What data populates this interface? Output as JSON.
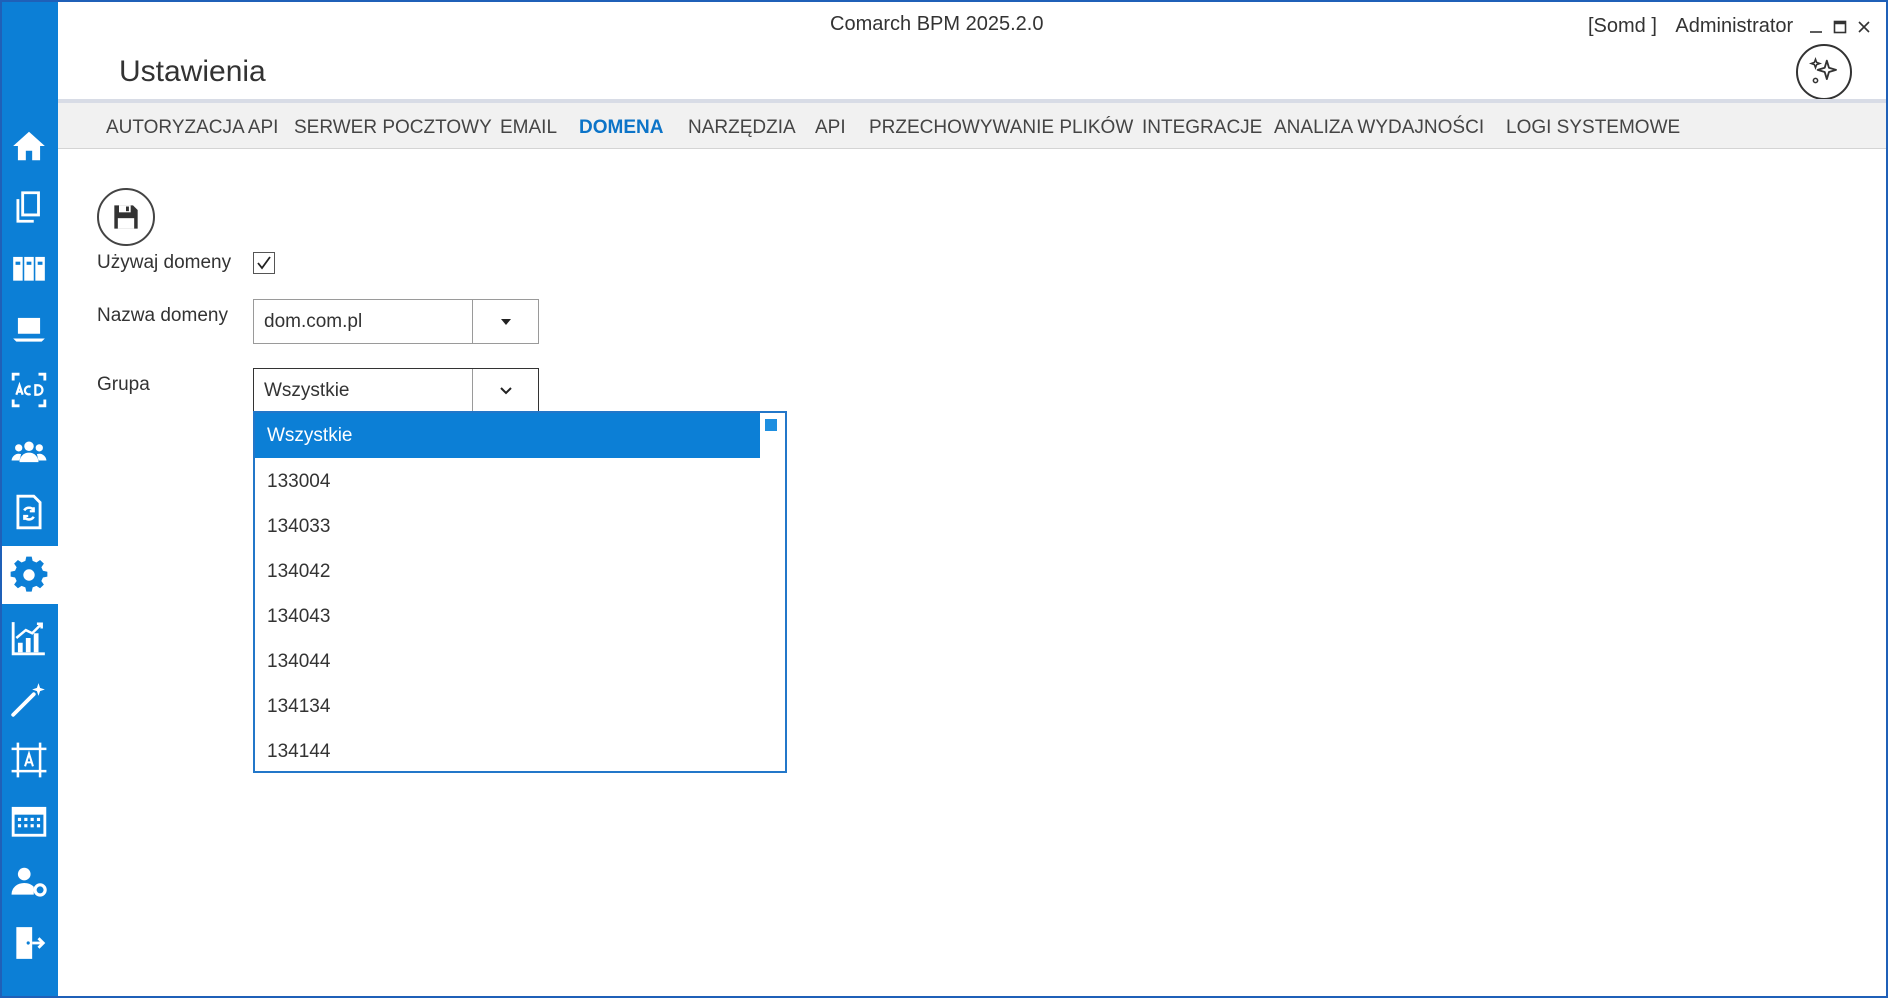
{
  "app": {
    "title": "Comarch BPM  2025.2.0",
    "environment": "[Somd ]",
    "user": "Administrator",
    "page_title": "Ustawienia"
  },
  "window_controls": {
    "minimize": "minimize-icon",
    "maximize": "maximize-icon",
    "close": "close-icon"
  },
  "sidebar": {
    "color": "#0c7fd6",
    "items": [
      {
        "icon": "home-icon"
      },
      {
        "icon": "documents-icon"
      },
      {
        "icon": "binders-icon"
      },
      {
        "icon": "laptop-icon"
      },
      {
        "icon": "acd-icon"
      },
      {
        "icon": "users-icon"
      },
      {
        "icon": "document-sync-icon"
      },
      {
        "icon": "gear-icon",
        "active": true
      },
      {
        "icon": "chart-icon"
      },
      {
        "icon": "magic-wand-icon"
      },
      {
        "icon": "designer-icon"
      },
      {
        "icon": "calendar-icon"
      },
      {
        "icon": "user-settings-icon"
      },
      {
        "icon": "logout-icon"
      }
    ]
  },
  "tabs": [
    {
      "label": "AUTORYZACJA API"
    },
    {
      "label": "SERWER POCZTOWY"
    },
    {
      "label": "EMAIL"
    },
    {
      "label": "DOMENA",
      "active": true
    },
    {
      "label": "NARZĘDZIA"
    },
    {
      "label": "API"
    },
    {
      "label": "PRZECHOWYWANIE PLIKÓW"
    },
    {
      "label": "INTEGRACJE"
    },
    {
      "label": "ANALIZA WYDAJNOŚCI"
    },
    {
      "label": "LOGI SYSTEMOWE"
    }
  ],
  "form": {
    "use_domain_label": "Używaj domeny",
    "use_domain_checked": true,
    "domain_name_label": "Nazwa domeny",
    "domain_name_value": "dom.com.pl",
    "group_label": "Grupa",
    "group_value": "Wszystkie"
  },
  "dropdown": {
    "options": [
      "Wszystkie",
      "133004",
      "134033",
      "134042",
      "134043",
      "134044",
      "134134",
      "134144"
    ],
    "selected_index": 0
  },
  "colors": {
    "accent": "#0c7fd6",
    "active_tab": "#0c74c8",
    "window_border": "#1f60b8"
  }
}
